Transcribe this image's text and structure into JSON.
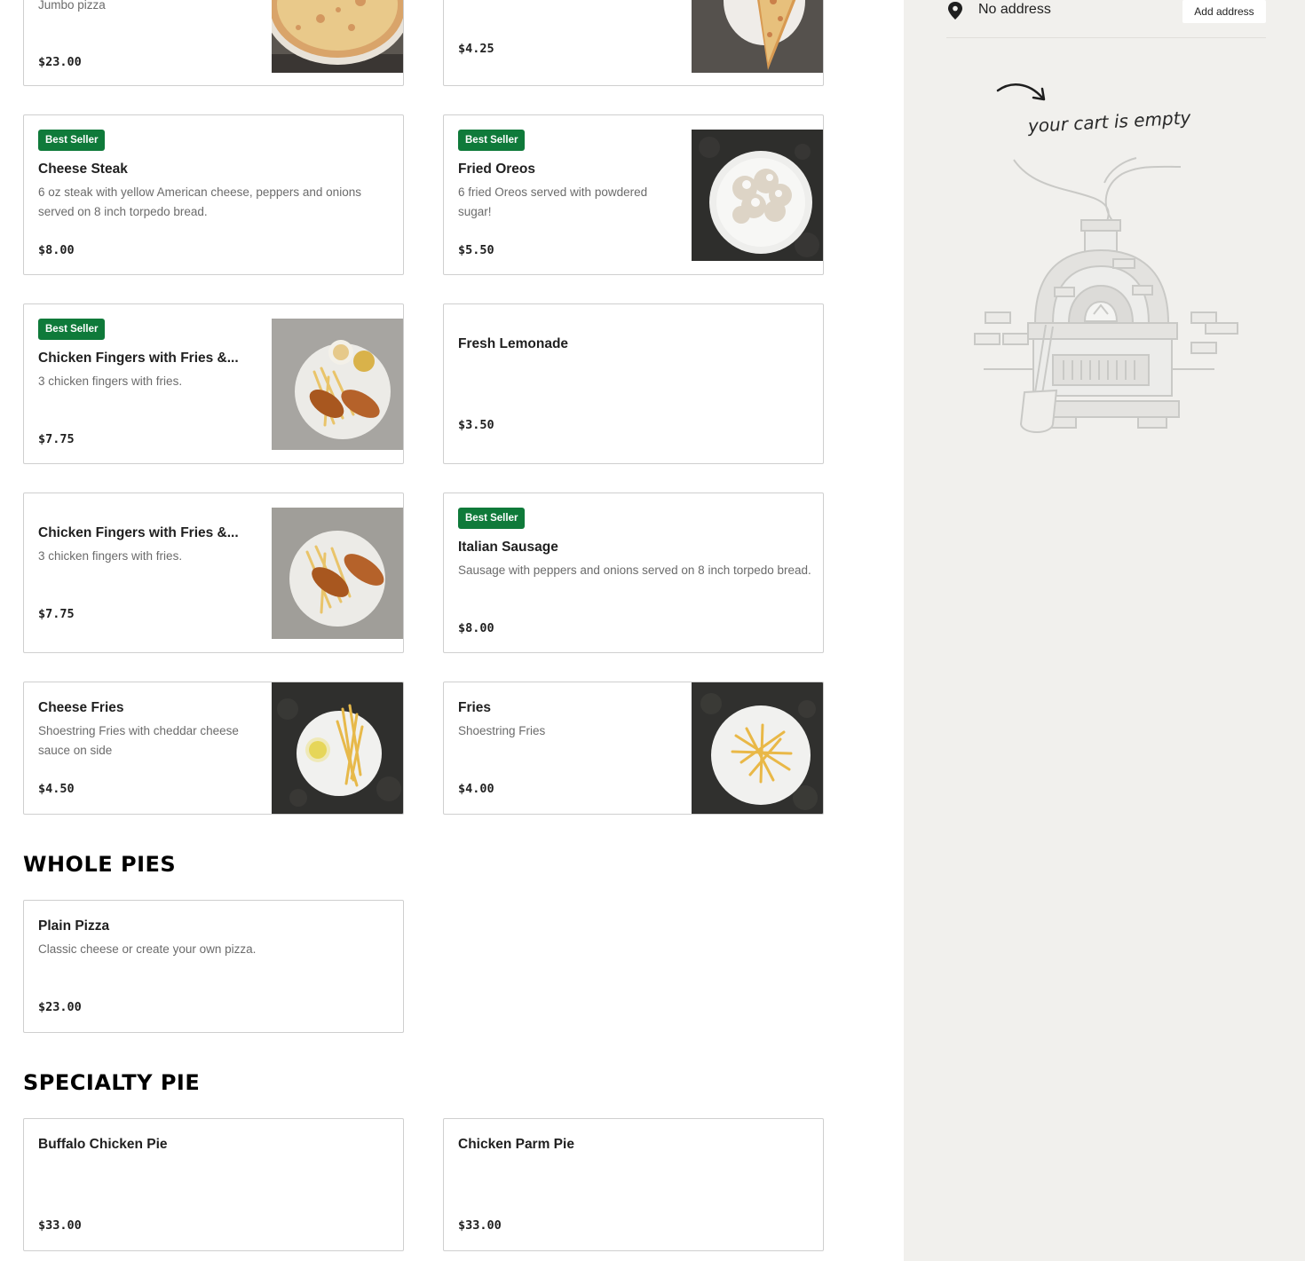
{
  "colors": {
    "badge": "#0f7a3a",
    "sidebar_bg": "#f1f0ed",
    "card_border": "#cfcfcf"
  },
  "top_cards": [
    {
      "description": "Jumbo pizza",
      "price": "$23.00",
      "image": "pizza-whole-photo"
    },
    {
      "price": "$4.25",
      "image": "pizza-slice-photo"
    }
  ],
  "items": [
    {
      "badge": "Best Seller",
      "name": "Cheese Steak",
      "description": "6 oz steak with yellow American cheese, peppers and onions served on 8 inch torpedo bread.",
      "price": "$8.00"
    },
    {
      "badge": "Best Seller",
      "name": "Fried Oreos",
      "description": "6 fried Oreos served with powdered sugar!",
      "price": "$5.50",
      "image": "fried-oreos-photo"
    },
    {
      "badge": "Best Seller",
      "name": "Chicken Fingers with Fries &...",
      "description": "3 chicken fingers with fries.",
      "price": "$7.75",
      "image": "chicken-fingers-photo"
    },
    {
      "name": "Fresh Lemonade",
      "price": "$3.50"
    },
    {
      "name": "Chicken Fingers with Fries &...",
      "description": "3 chicken fingers with fries.",
      "price": "$7.75",
      "image": "chicken-fingers-photo"
    },
    {
      "badge": "Best Seller",
      "name": "Italian Sausage",
      "description": "Sausage with peppers and onions served on 8 inch torpedo bread.",
      "price": "$8.00"
    },
    {
      "name": "Cheese Fries",
      "description": "Shoestring Fries with cheddar cheese sauce on side",
      "price": "$4.50",
      "image": "cheese-fries-photo"
    },
    {
      "name": "Fries",
      "description": "Shoestring Fries",
      "price": "$4.00",
      "image": "fries-photo"
    }
  ],
  "sections": [
    {
      "title": "WHOLE PIES",
      "items": [
        {
          "name": "Plain Pizza",
          "description": "Classic cheese or create your own pizza.",
          "price": "$23.00"
        }
      ]
    },
    {
      "title": "SPECIALTY PIE",
      "items": [
        {
          "name": "Buffalo Chicken Pie",
          "price": "$33.00"
        },
        {
          "name": "Chicken Parm Pie",
          "price": "$33.00"
        }
      ]
    }
  ],
  "sidebar": {
    "address_text": "No address",
    "add_address_label": "Add address",
    "cart_empty_text": "your cart is empty",
    "icons": {
      "pin": "location-pin-icon",
      "arrow": "curved-arrow-icon",
      "oven": "pizza-oven-illustration"
    }
  }
}
